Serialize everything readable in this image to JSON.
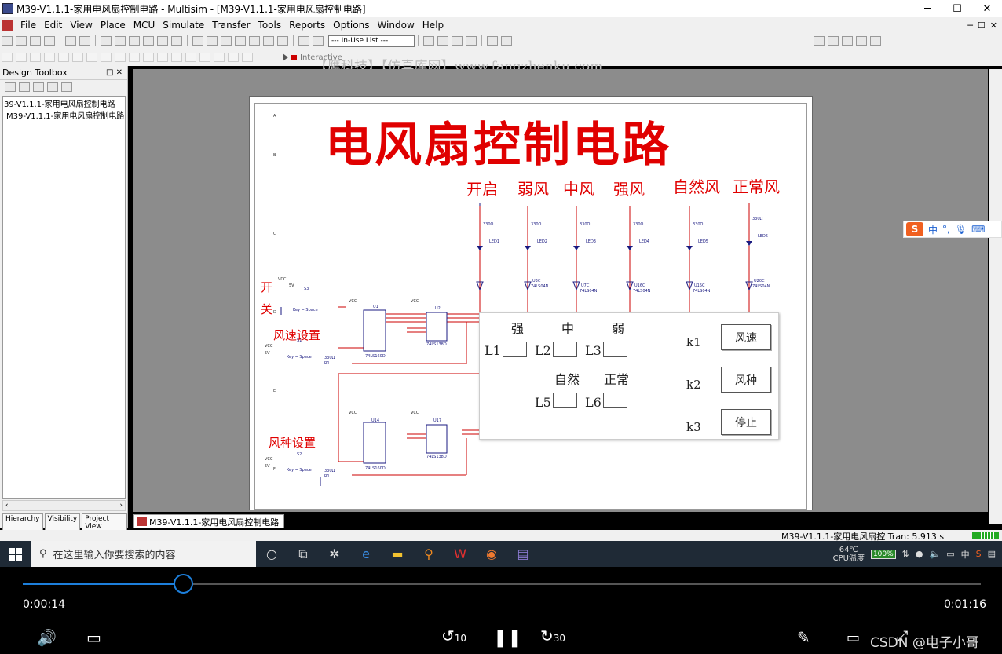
{
  "window": {
    "title": "M39-V1.1.1-家用电风扇控制电路 - Multisim - [M39-V1.1.1-家用电风扇控制电路]",
    "min": "─",
    "max": "☐",
    "close": "✕"
  },
  "menu": [
    "File",
    "Edit",
    "View",
    "Place",
    "MCU",
    "Simulate",
    "Transfer",
    "Tools",
    "Reports",
    "Options",
    "Window",
    "Help"
  ],
  "toolbar": {
    "in_use_list": "--- In-Use List ---",
    "interactive": "Interactive"
  },
  "watermark": "【鹰科技】【仿真库网】www.fangzhenku.com",
  "toolbox": {
    "title": "Design Toolbox",
    "tree": [
      "39-V1.1.1-家用电风扇控制电路",
      "M39-V1.1.1-家用电风扇控制电路"
    ],
    "tabs": [
      "Hierarchy",
      "Visibility",
      "Project View"
    ]
  },
  "schematic": {
    "title": "电风扇控制电路",
    "modes": [
      "开启",
      "弱风",
      "中风",
      "强风",
      "自然风",
      "正常风"
    ],
    "side_labels": {
      "open1": "开",
      "open2": "关",
      "speed": "风速设置",
      "type": "风种设置"
    },
    "leds": [
      "LED1",
      "LED2",
      "LED3",
      "LED4",
      "LED5",
      "LED6"
    ],
    "gates": [
      "U3C",
      "U7C",
      "U16C",
      "U15C",
      "U20C"
    ],
    "gate_part": "74LS04N",
    "resistor": "330Ω",
    "chips": {
      "u1": "U1",
      "u2": "U2",
      "u14": "U14",
      "u17": "U17",
      "counter": "74LS160D",
      "decoder": "74LS138D"
    },
    "switches": {
      "s3": "S3",
      "s1": "S1",
      "s2": "S2",
      "key": "Key = Space",
      "vcc": "VCC",
      "v5": "5V",
      "r1": "R1"
    }
  },
  "panel": {
    "headers": [
      "强",
      "中",
      "弱"
    ],
    "leds_top": [
      "L1",
      "L2",
      "L3"
    ],
    "headers2": [
      "自然",
      "正常"
    ],
    "leds_bottom": [
      "L5",
      "L6"
    ],
    "keys": [
      "k1",
      "k2",
      "k3"
    ],
    "buttons": [
      "风速",
      "风种",
      "停止"
    ]
  },
  "doc_tab": "M39-V1.1.1-家用电风扇控制电路",
  "status": "M39-V1.1.1-家用电风扇控 Tran: 5.913 s",
  "ime": {
    "logo": "S",
    "lang": "中"
  },
  "taskbar": {
    "search_placeholder": "在这里输入你要搜索的内容",
    "temp": "64℃",
    "temp_label": "CPU温度",
    "battery": "100%",
    "lang": "中"
  },
  "player": {
    "current": "0:00:14",
    "total": "0:01:16",
    "progress": 0.167,
    "skip_back": "10",
    "skip_fwd": "30",
    "brand": "CSDN @电子小哥"
  }
}
